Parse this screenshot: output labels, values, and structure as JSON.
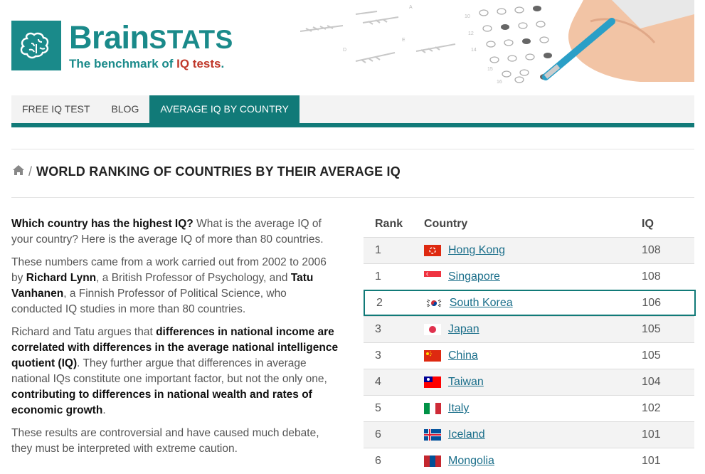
{
  "header": {
    "brand_brain": "Brain",
    "brand_stats": "STATS",
    "tagline_prefix": "The benchmark of ",
    "tagline_highlight": "IQ tests",
    "tagline_suffix": "."
  },
  "nav": {
    "items": [
      {
        "label": "FREE IQ TEST"
      },
      {
        "label": "BLOG"
      },
      {
        "label": "AVERAGE IQ BY COUNTRY"
      }
    ]
  },
  "breadcrumb": {
    "separator": "/",
    "title": "WORLD RANKING OF COUNTRIES BY THEIR AVERAGE IQ"
  },
  "intro": {
    "p1_bold": "Which country has the highest IQ?",
    "p1_text": " What is the average IQ of your country? Here is the average IQ of more than 80 countries.",
    "p2_a": "These numbers came from a work carried out from 2002 to 2006 by ",
    "p2_b1": "Richard Lynn",
    "p2_c": ", a British Professor of Psychology, and ",
    "p2_b2": "Tatu Vanhanen",
    "p2_d": ", a Finnish Professor of Political Science, who conducted IQ studies in more than 80 countries.",
    "p3_a": "Richard and Tatu argues that ",
    "p3_b1": "differences in national income are correlated with differences in the average national intelligence quotient (IQ)",
    "p3_c": ". They further argue that differences in average national IQs constitute one important factor, but not the only one, ",
    "p3_b2": "contributing to differences in national wealth and rates of economic growth",
    "p3_d": ".",
    "p4": "These results are controversial and have caused much debate, they must be interpreted with extreme caution."
  },
  "table": {
    "headers": {
      "rank": "Rank",
      "country": "Country",
      "iq": "IQ"
    },
    "rows": [
      {
        "rank": "1",
        "country": "Hong Kong",
        "iq": "108",
        "flag": "hong-kong-flag"
      },
      {
        "rank": "1",
        "country": "Singapore",
        "iq": "108",
        "flag": "singapore-flag"
      },
      {
        "rank": "2",
        "country": "South Korea",
        "iq": "106",
        "flag": "south-korea-flag"
      },
      {
        "rank": "3",
        "country": "Japan",
        "iq": "105",
        "flag": "japan-flag"
      },
      {
        "rank": "3",
        "country": "China",
        "iq": "105",
        "flag": "china-flag"
      },
      {
        "rank": "4",
        "country": "Taiwan",
        "iq": "104",
        "flag": "taiwan-flag"
      },
      {
        "rank": "5",
        "country": "Italy",
        "iq": "102",
        "flag": "italy-flag"
      },
      {
        "rank": "6",
        "country": "Iceland",
        "iq": "101",
        "flag": "iceland-flag"
      },
      {
        "rank": "6",
        "country": "Mongolia",
        "iq": "101",
        "flag": "mongolia-flag"
      }
    ]
  },
  "colors": {
    "brand": "#1a8a8a",
    "nav_active": "#117a78",
    "accent_red": "#c0392b"
  }
}
